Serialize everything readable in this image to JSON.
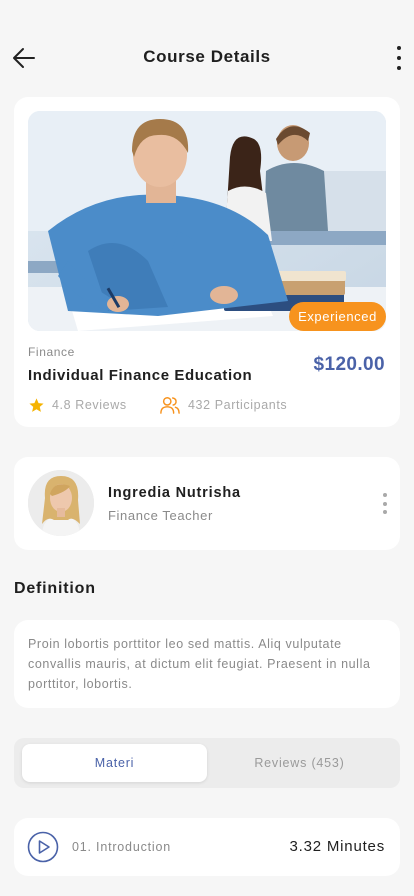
{
  "header": {
    "title": "Course Details",
    "back_icon": "arrow-left-icon",
    "more_icon": "vertical-dots-icon"
  },
  "course": {
    "level_badge": "Experienced",
    "category": "Finance",
    "title": "Individual Finance Education",
    "price": "$120.00",
    "reviews": "4.8 Reviews",
    "participants": "432 Participants"
  },
  "teacher": {
    "name": "Ingredia Nutrisha",
    "role": "Finance Teacher"
  },
  "definition": {
    "heading": "Definition",
    "text": "Proin lobortis porttitor leo sed mattis. Aliq vulputate convallis mauris, at dictum elit feugiat. Praesent in nulla porttitor, lobortis."
  },
  "tabs": [
    {
      "label": "Materi",
      "active": true
    },
    {
      "label": "Reviews (453)",
      "active": false
    }
  ],
  "lessons": [
    {
      "title": "01. Introduction",
      "duration": "3.32 Minutes"
    }
  ],
  "colors": {
    "accent": "#4a62a8",
    "badge": "#f7931e",
    "star": "#f5b301",
    "background": "#f6f6f6"
  }
}
